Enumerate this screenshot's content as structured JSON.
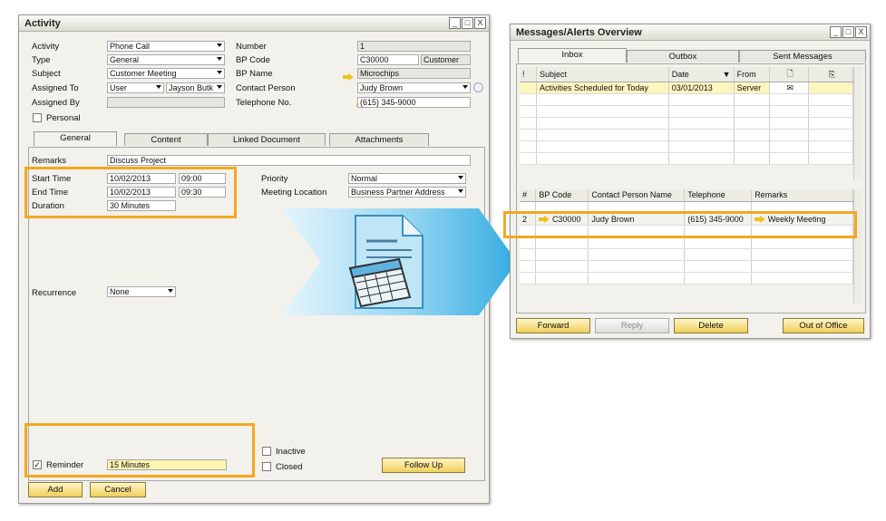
{
  "activity": {
    "title": "Activity",
    "window_buttons": [
      "_",
      "□",
      "X"
    ],
    "fields": {
      "activity_label": "Activity",
      "activity_value": "Phone Call",
      "type_label": "Type",
      "type_value": "General",
      "subject_label": "Subject",
      "subject_value": "Customer Meeting",
      "assigned_to_label": "Assigned To",
      "assigned_to_value": "User",
      "assigned_to_name": "Jayson Butk",
      "assigned_by_label": "Assigned By",
      "personal_label": "Personal",
      "number_label": "Number",
      "number_value": "1",
      "bp_code_label": "BP Code",
      "bp_code_value": "C30000",
      "customer_value": "Customer",
      "bp_name_label": "BP Name",
      "bp_name_value": "Microchips",
      "contact_person_label": "Contact Person",
      "contact_person_value": "Judy Brown",
      "telephone_label": "Telephone No.",
      "telephone_value": "(615) 345-9000"
    },
    "tabs": [
      "General",
      "Content",
      "Linked Document",
      "Attachments"
    ],
    "general": {
      "remarks_label": "Remarks",
      "remarks_value": "Discuss Project",
      "start_time_label": "Start Time",
      "start_date": "10/02/2013",
      "start_time": "09:00",
      "end_time_label": "End Time",
      "end_date": "10/02/2013",
      "end_time": "09:30",
      "duration_label": "Duration",
      "duration_value": "30 Minutes",
      "priority_label": "Priority",
      "priority_value": "Normal",
      "meeting_location_label": "Meeting Location",
      "meeting_location_value": "Business Partner Address",
      "recurrence_label": "Recurrence",
      "recurrence_value": "None",
      "reminder_label": "Reminder",
      "reminder_value": "15 Minutes",
      "inactive_label": "Inactive",
      "closed_label": "Closed",
      "follow_up_label": "Follow Up"
    },
    "buttons": {
      "add": "Add",
      "cancel": "Cancel"
    }
  },
  "messages": {
    "title": "Messages/Alerts Overview",
    "tabs": [
      "Inbox",
      "Outbox",
      "Sent Messages"
    ],
    "top_columns": [
      "!",
      "Subject",
      "Date",
      "From"
    ],
    "top_rows": [
      {
        "subject": "Activities Scheduled for Today",
        "date": "03/01/2013",
        "from": "Server"
      }
    ],
    "bottom_columns": [
      "#",
      "BP Code",
      "Contact Person Name",
      "Telephone",
      "Remarks"
    ],
    "bottom_rows": [
      {
        "num": "2",
        "bp_code": "C30000",
        "contact": "Judy Brown",
        "telephone": "(615) 345-9000",
        "remarks": "Weekly Meeting"
      }
    ],
    "buttons": {
      "forward": "Forward",
      "reply": "Reply",
      "delete": "Delete",
      "out_of_office": "Out of Office"
    }
  },
  "colors": {
    "highlight": "#f2a81f",
    "arrow_blue": "#4ab8e8",
    "row_yellow": "#fdf6bf"
  },
  "icons": [
    "calendar-document-icon",
    "envelope-icon",
    "new-document-icon",
    "paperclip-icon",
    "link-arrow-icon"
  ]
}
